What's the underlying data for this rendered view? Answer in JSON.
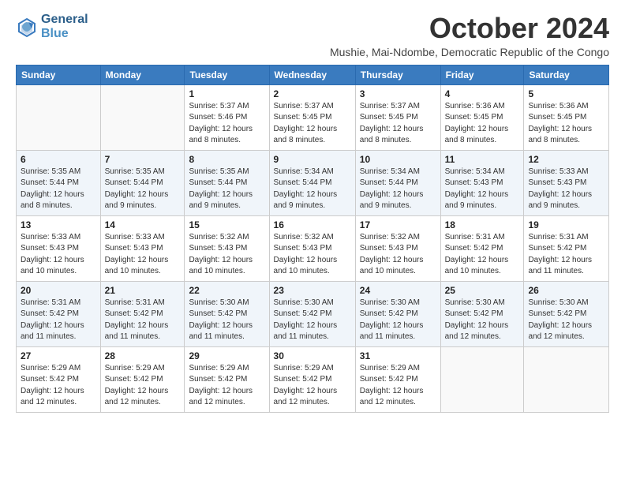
{
  "header": {
    "logo_line1": "General",
    "logo_line2": "Blue",
    "month": "October 2024",
    "location": "Mushie, Mai-Ndombe, Democratic Republic of the Congo"
  },
  "weekdays": [
    "Sunday",
    "Monday",
    "Tuesday",
    "Wednesday",
    "Thursday",
    "Friday",
    "Saturday"
  ],
  "weeks": [
    [
      {
        "day": "",
        "info": ""
      },
      {
        "day": "",
        "info": ""
      },
      {
        "day": "1",
        "info": "Sunrise: 5:37 AM\nSunset: 5:46 PM\nDaylight: 12 hours and 8 minutes."
      },
      {
        "day": "2",
        "info": "Sunrise: 5:37 AM\nSunset: 5:45 PM\nDaylight: 12 hours and 8 minutes."
      },
      {
        "day": "3",
        "info": "Sunrise: 5:37 AM\nSunset: 5:45 PM\nDaylight: 12 hours and 8 minutes."
      },
      {
        "day": "4",
        "info": "Sunrise: 5:36 AM\nSunset: 5:45 PM\nDaylight: 12 hours and 8 minutes."
      },
      {
        "day": "5",
        "info": "Sunrise: 5:36 AM\nSunset: 5:45 PM\nDaylight: 12 hours and 8 minutes."
      }
    ],
    [
      {
        "day": "6",
        "info": "Sunrise: 5:35 AM\nSunset: 5:44 PM\nDaylight: 12 hours and 8 minutes."
      },
      {
        "day": "7",
        "info": "Sunrise: 5:35 AM\nSunset: 5:44 PM\nDaylight: 12 hours and 9 minutes."
      },
      {
        "day": "8",
        "info": "Sunrise: 5:35 AM\nSunset: 5:44 PM\nDaylight: 12 hours and 9 minutes."
      },
      {
        "day": "9",
        "info": "Sunrise: 5:34 AM\nSunset: 5:44 PM\nDaylight: 12 hours and 9 minutes."
      },
      {
        "day": "10",
        "info": "Sunrise: 5:34 AM\nSunset: 5:44 PM\nDaylight: 12 hours and 9 minutes."
      },
      {
        "day": "11",
        "info": "Sunrise: 5:34 AM\nSunset: 5:43 PM\nDaylight: 12 hours and 9 minutes."
      },
      {
        "day": "12",
        "info": "Sunrise: 5:33 AM\nSunset: 5:43 PM\nDaylight: 12 hours and 9 minutes."
      }
    ],
    [
      {
        "day": "13",
        "info": "Sunrise: 5:33 AM\nSunset: 5:43 PM\nDaylight: 12 hours and 10 minutes."
      },
      {
        "day": "14",
        "info": "Sunrise: 5:33 AM\nSunset: 5:43 PM\nDaylight: 12 hours and 10 minutes."
      },
      {
        "day": "15",
        "info": "Sunrise: 5:32 AM\nSunset: 5:43 PM\nDaylight: 12 hours and 10 minutes."
      },
      {
        "day": "16",
        "info": "Sunrise: 5:32 AM\nSunset: 5:43 PM\nDaylight: 12 hours and 10 minutes."
      },
      {
        "day": "17",
        "info": "Sunrise: 5:32 AM\nSunset: 5:43 PM\nDaylight: 12 hours and 10 minutes."
      },
      {
        "day": "18",
        "info": "Sunrise: 5:31 AM\nSunset: 5:42 PM\nDaylight: 12 hours and 10 minutes."
      },
      {
        "day": "19",
        "info": "Sunrise: 5:31 AM\nSunset: 5:42 PM\nDaylight: 12 hours and 11 minutes."
      }
    ],
    [
      {
        "day": "20",
        "info": "Sunrise: 5:31 AM\nSunset: 5:42 PM\nDaylight: 12 hours and 11 minutes."
      },
      {
        "day": "21",
        "info": "Sunrise: 5:31 AM\nSunset: 5:42 PM\nDaylight: 12 hours and 11 minutes."
      },
      {
        "day": "22",
        "info": "Sunrise: 5:30 AM\nSunset: 5:42 PM\nDaylight: 12 hours and 11 minutes."
      },
      {
        "day": "23",
        "info": "Sunrise: 5:30 AM\nSunset: 5:42 PM\nDaylight: 12 hours and 11 minutes."
      },
      {
        "day": "24",
        "info": "Sunrise: 5:30 AM\nSunset: 5:42 PM\nDaylight: 12 hours and 11 minutes."
      },
      {
        "day": "25",
        "info": "Sunrise: 5:30 AM\nSunset: 5:42 PM\nDaylight: 12 hours and 12 minutes."
      },
      {
        "day": "26",
        "info": "Sunrise: 5:30 AM\nSunset: 5:42 PM\nDaylight: 12 hours and 12 minutes."
      }
    ],
    [
      {
        "day": "27",
        "info": "Sunrise: 5:29 AM\nSunset: 5:42 PM\nDaylight: 12 hours and 12 minutes."
      },
      {
        "day": "28",
        "info": "Sunrise: 5:29 AM\nSunset: 5:42 PM\nDaylight: 12 hours and 12 minutes."
      },
      {
        "day": "29",
        "info": "Sunrise: 5:29 AM\nSunset: 5:42 PM\nDaylight: 12 hours and 12 minutes."
      },
      {
        "day": "30",
        "info": "Sunrise: 5:29 AM\nSunset: 5:42 PM\nDaylight: 12 hours and 12 minutes."
      },
      {
        "day": "31",
        "info": "Sunrise: 5:29 AM\nSunset: 5:42 PM\nDaylight: 12 hours and 12 minutes."
      },
      {
        "day": "",
        "info": ""
      },
      {
        "day": "",
        "info": ""
      }
    ]
  ]
}
